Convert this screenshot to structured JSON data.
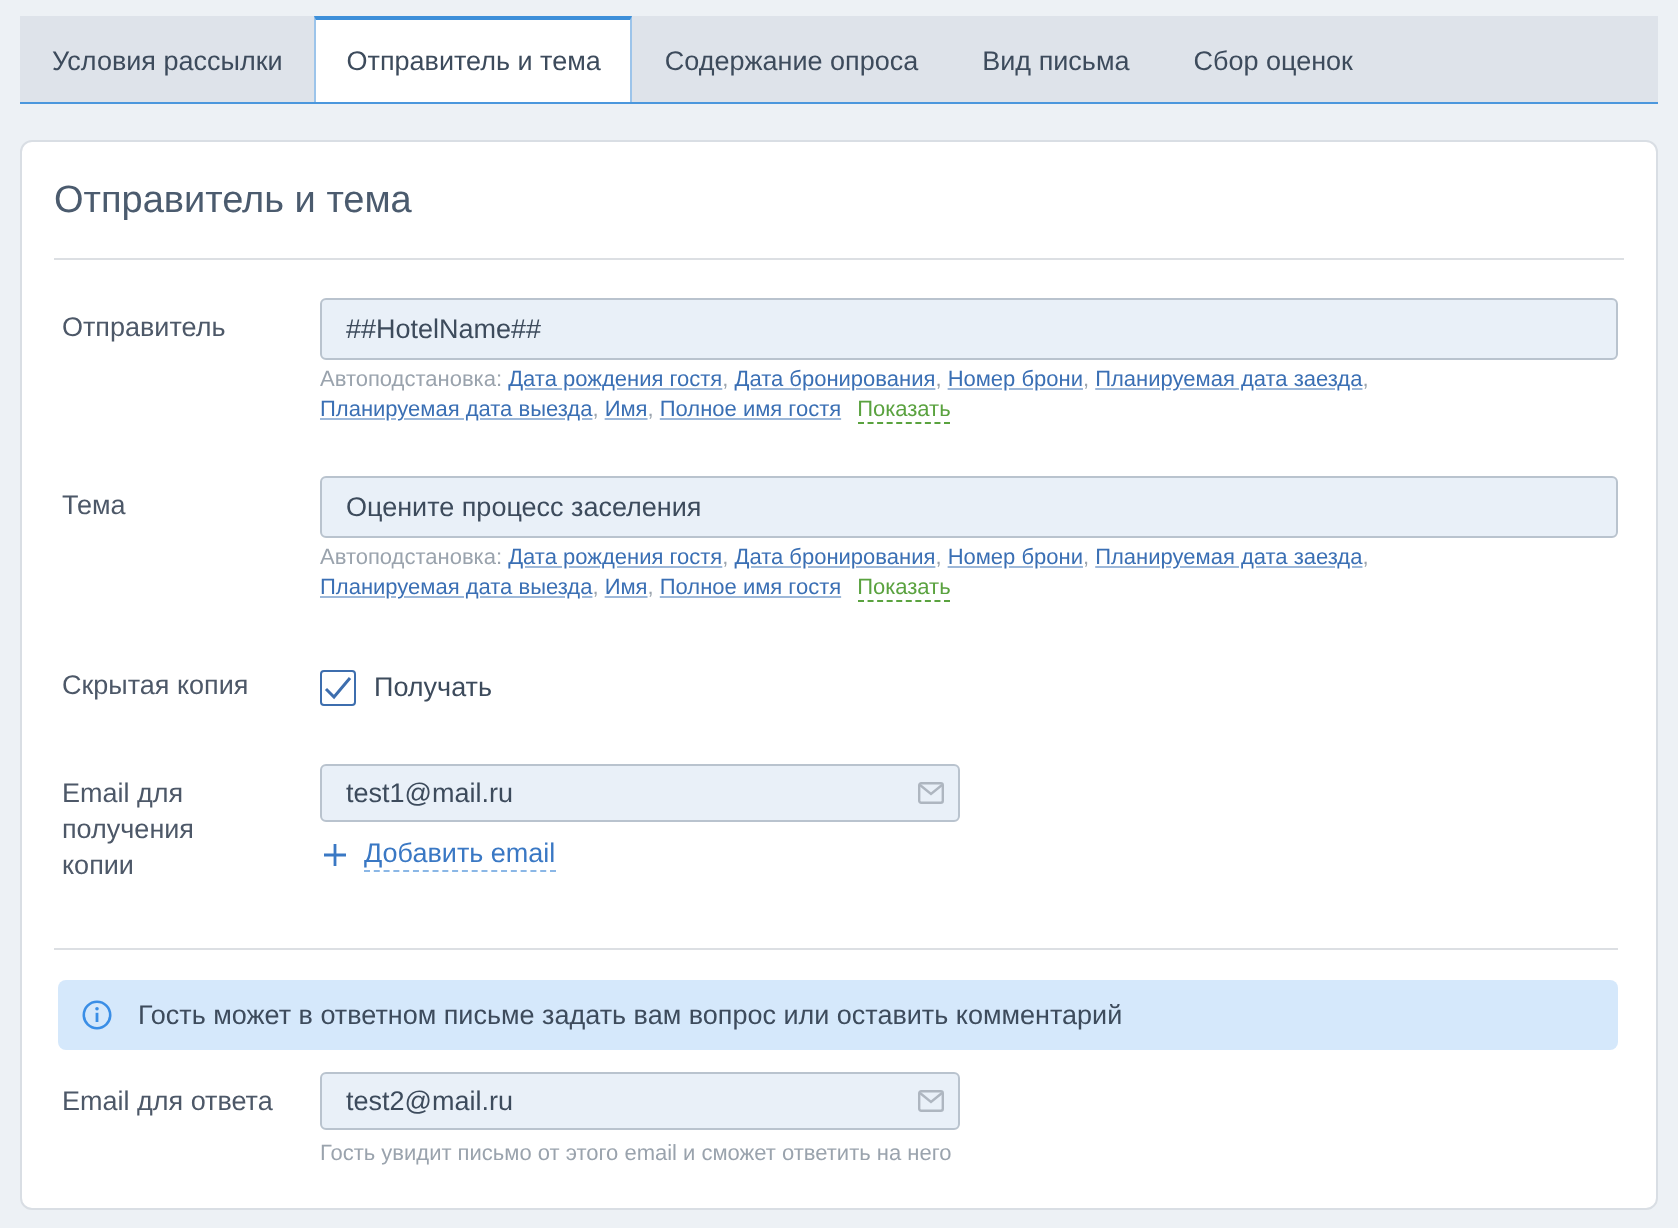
{
  "tabs": [
    {
      "label": "Условия рассылки",
      "selected": false
    },
    {
      "label": "Отправитель и тема",
      "selected": true
    },
    {
      "label": "Содержание опроса",
      "selected": false
    },
    {
      "label": "Вид письма",
      "selected": false
    },
    {
      "label": "Сбор оценок",
      "selected": false
    }
  ],
  "section": {
    "title": "Отправитель и тема"
  },
  "fields": [
    {
      "kind": "text",
      "label": "Отправитель",
      "value": "##HotelName##",
      "autofill": {
        "label": "Автоподстановка:",
        "separator": ",",
        "items": [
          "Дата рождения гостя",
          "Дата бронирования",
          "Номер брони",
          "Планируемая дата заезда",
          "Планируемая дата выезда",
          "Имя",
          "Полное имя гостя"
        ],
        "toggle": "Показать"
      }
    },
    {
      "kind": "text",
      "label": "Тема",
      "value": "Оцените процесс заселения",
      "autofill": {
        "label": "Автоподстановка:",
        "separator": ",",
        "items": [
          "Дата рождения гостя",
          "Дата бронирования",
          "Номер брони",
          "Планируемая дата заезда",
          "Планируемая дата выезда",
          "Имя",
          "Полное имя гостя"
        ],
        "toggle": "Показать"
      }
    },
    {
      "kind": "checkbox",
      "label": "Скрытая копия",
      "option": "Получать",
      "checked": true
    },
    {
      "kind": "email",
      "label": "Email для получения копии",
      "value": "test1@mail.ru",
      "add_link": "Добавить email"
    }
  ],
  "notice": {
    "text": "Гость может в ответном письме задать вам вопрос или оставить комментарий"
  },
  "reply_fields": [
    {
      "kind": "email",
      "label": "Email для ответа",
      "value": "test2@mail.ru",
      "hint": "Гость увидит письмо от этого email и сможет ответить на него"
    }
  ]
}
